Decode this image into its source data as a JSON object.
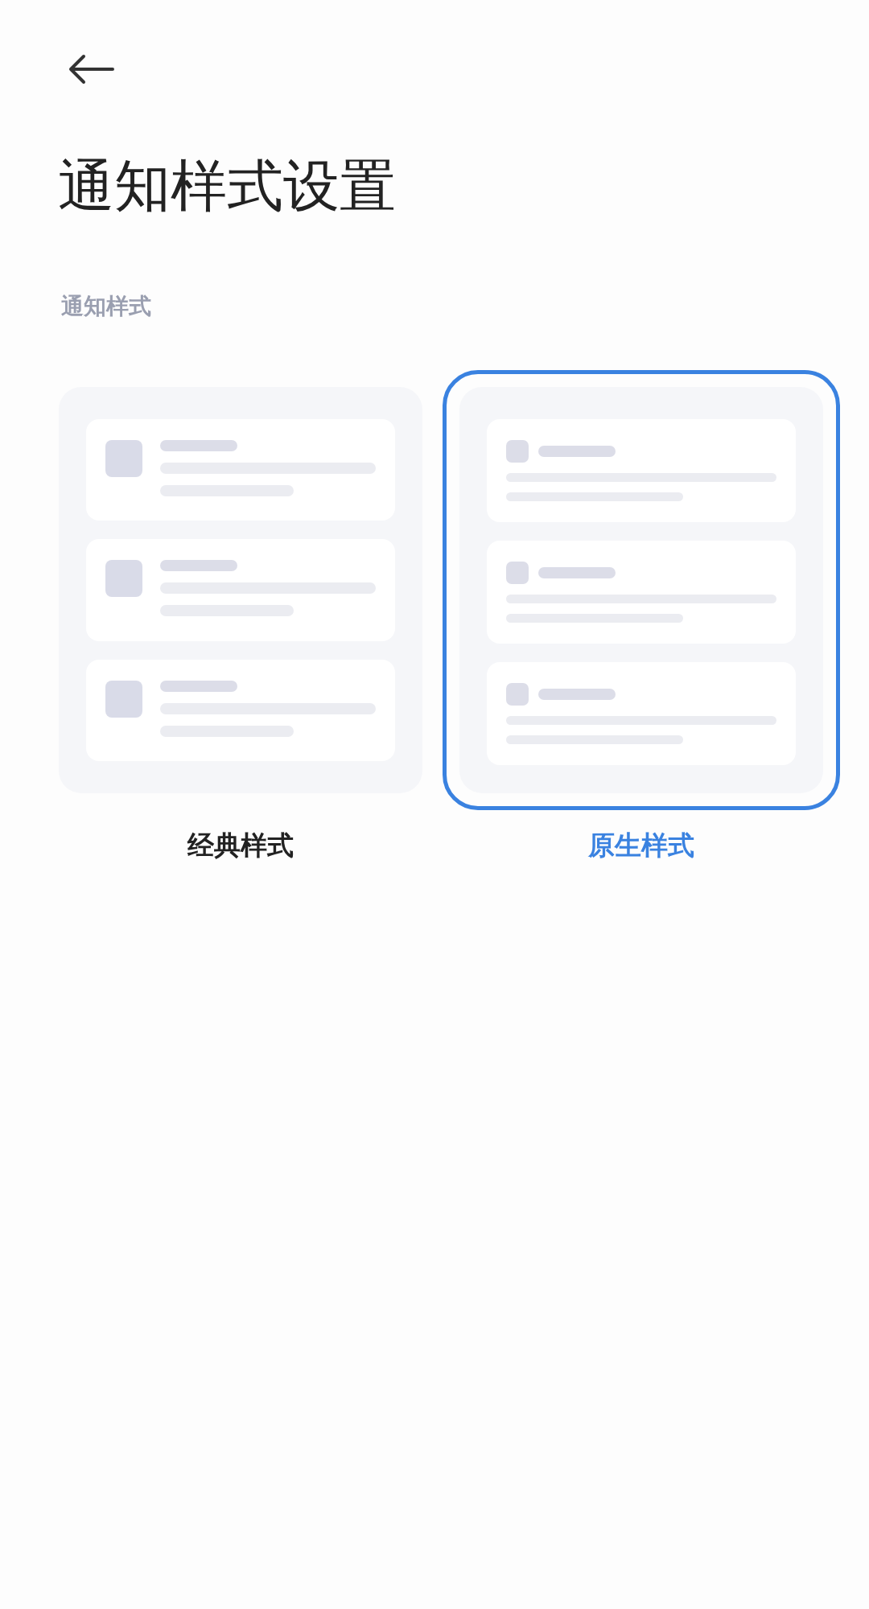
{
  "header": {
    "title": "通知样式设置"
  },
  "section": {
    "label": "通知样式"
  },
  "styles": [
    {
      "label": "经典样式",
      "kind": "classic",
      "selected": false
    },
    {
      "label": "原生样式",
      "kind": "native",
      "selected": true
    }
  ]
}
